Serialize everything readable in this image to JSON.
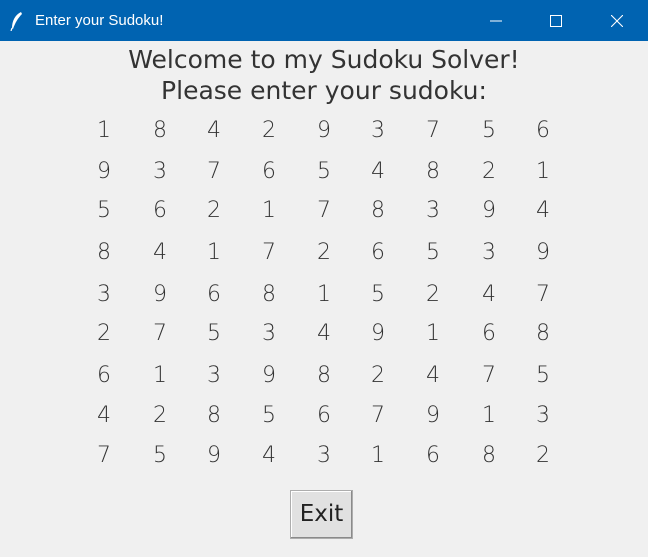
{
  "window": {
    "title": "Enter your Sudoku!",
    "titlebar_color": "#0063b1",
    "icon": "feather-icon",
    "controls": [
      "minimize-icon",
      "maximize-icon",
      "close-icon"
    ]
  },
  "heading": {
    "line1": "Welcome to my Sudoku Solver!",
    "line2": "Please enter your sudoku:"
  },
  "sudoku": {
    "rows": [
      [
        "1",
        "8",
        "4",
        "2",
        "9",
        "3",
        "7",
        "5",
        "6"
      ],
      [
        "9",
        "3",
        "7",
        "6",
        "5",
        "4",
        "8",
        "2",
        "1"
      ],
      [
        "5",
        "6",
        "2",
        "1",
        "7",
        "8",
        "3",
        "9",
        "4"
      ],
      [
        "8",
        "4",
        "1",
        "7",
        "2",
        "6",
        "5",
        "3",
        "9"
      ],
      [
        "3",
        "9",
        "6",
        "8",
        "1",
        "5",
        "2",
        "4",
        "7"
      ],
      [
        "2",
        "7",
        "5",
        "3",
        "4",
        "9",
        "1",
        "6",
        "8"
      ],
      [
        "6",
        "1",
        "3",
        "9",
        "8",
        "2",
        "4",
        "7",
        "5"
      ],
      [
        "4",
        "2",
        "8",
        "5",
        "6",
        "7",
        "9",
        "1",
        "3"
      ],
      [
        "7",
        "5",
        "9",
        "4",
        "3",
        "1",
        "6",
        "8",
        "2"
      ]
    ]
  },
  "buttons": {
    "exit_label": "Exit"
  }
}
